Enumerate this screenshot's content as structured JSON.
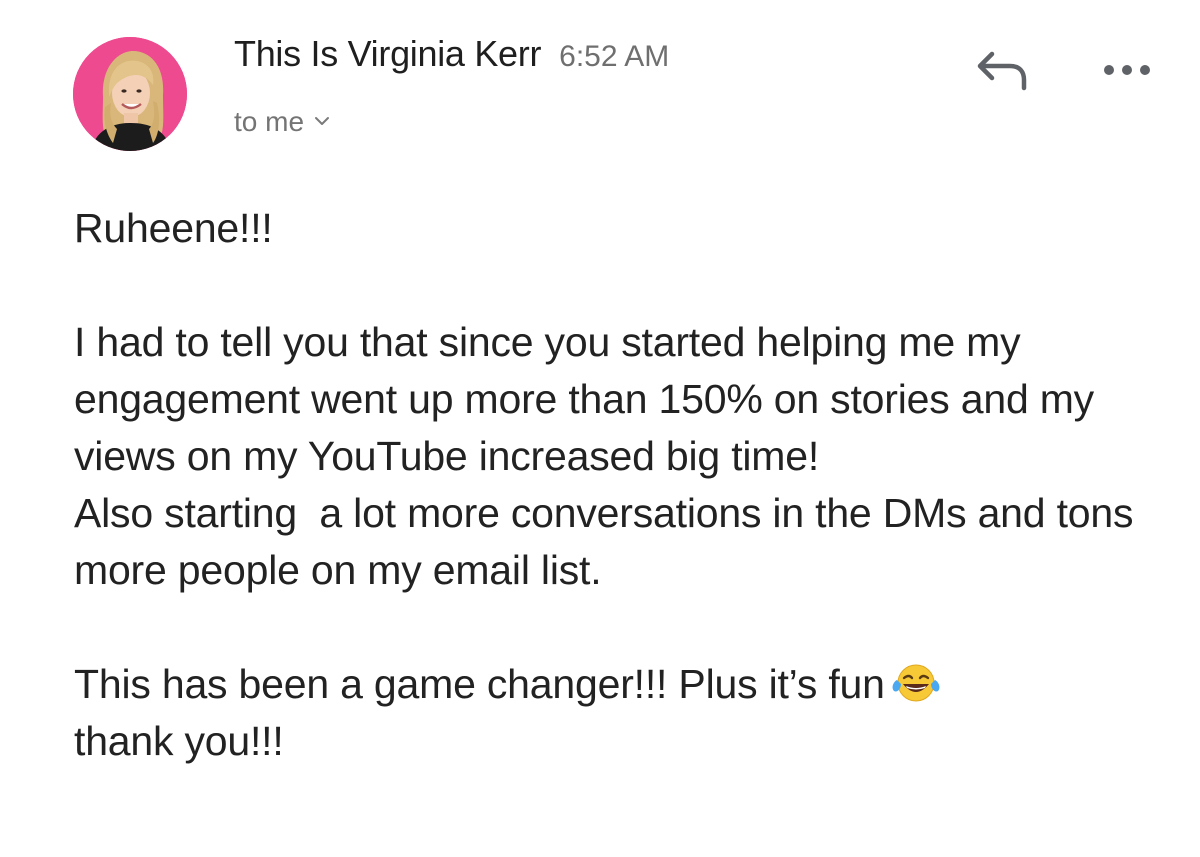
{
  "header": {
    "sender_name": "This Is Virginia Kerr",
    "time": "6:52 AM",
    "recipient_label": "to me",
    "avatar_bg": "#ee4a8f",
    "icons": {
      "reply": "reply-arrow-icon",
      "more": "more-horizontal-icon",
      "chevron": "chevron-down-icon"
    }
  },
  "message": {
    "greeting": "Ruheene!!!",
    "paragraph_1": "I had to tell you that since you started helping me my engagement went up more than 150% on stories and my views on my YouTube increased big time!",
    "paragraph_2": "Also starting  a lot more conversations in the DMs and tons more people on my email list.",
    "paragraph_3_start": "This has been a game changer!!! Plus it’s fun",
    "emoji": "tears-of-joy-emoji",
    "paragraph_3_end": "thank you!!!"
  }
}
